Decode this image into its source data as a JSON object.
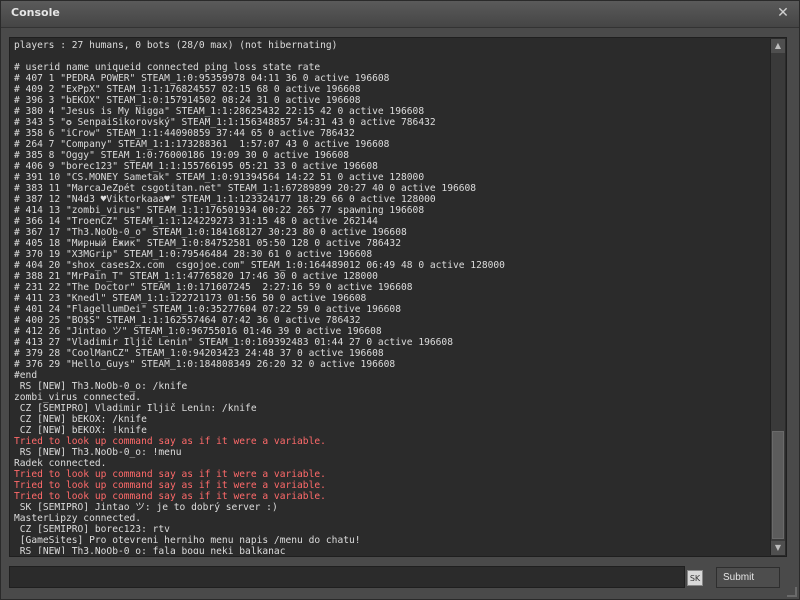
{
  "window": {
    "title": "Console",
    "close_icon": "close-icon"
  },
  "console": {
    "lines": [
      {
        "text": "players : 27 humans, 0 bots (28/0 max) (not hibernating)",
        "type": "normal"
      },
      {
        "text": "",
        "type": "normal"
      },
      {
        "text": "# userid name uniqueid connected ping loss state rate",
        "type": "normal"
      },
      {
        "text": "# 407 1 \"PEDRA POWER\" STEAM_1:0:95359978 04:11 36 0 active 196608",
        "type": "normal"
      },
      {
        "text": "# 409 2 \"ExPpX\" STEAM_1:1:176824557 02:15 68 0 active 196608",
        "type": "normal"
      },
      {
        "text": "# 396 3 \"bEKOX\" STEAM_1:0:157914502 08:24 31 0 active 196608",
        "type": "normal"
      },
      {
        "text": "# 380 4 \"Jesus is My Nigga\" STEAM_1:1:28625432 22:15 42 0 active 196608",
        "type": "normal"
      },
      {
        "text": "# 343 5 \"✪ SenpaiSikorovský\" STEAM_1:1:156348857 54:31 43 0 active 786432",
        "type": "normal"
      },
      {
        "text": "# 358 6 \"iCrow\" STEAM_1:1:44090859 37:44 65 0 active 786432",
        "type": "normal"
      },
      {
        "text": "# 264 7 \"Company\" STEAM_1:1:173288361  1:57:07 43 0 active 196608",
        "type": "normal"
      },
      {
        "text": "# 385 8 \"Oggy\" STEAM_1:0:76000186 19:09 30 0 active 196608",
        "type": "normal"
      },
      {
        "text": "# 406 9 \"borec123\" STEAM_1:1:155766195 05:21 33 0 active 196608",
        "type": "normal"
      },
      {
        "text": "# 391 10 \"CS.MONEY Sametak\" STEAM_1:0:91394564 14:22 51 0 active 128000",
        "type": "normal"
      },
      {
        "text": "# 383 11 \"MarcaJeZpét csgotitan.net\" STEAM_1:1:67289899 20:27 40 0 active 196608",
        "type": "normal"
      },
      {
        "text": "# 387 12 \"N4d3 ♥Viktorkaaa♥\" STEAM_1:1:123324177 18:29 66 0 active 128000",
        "type": "normal"
      },
      {
        "text": "# 414 13 \"zombi_virus\" STEAM_1:1:176501934 00:22 265 77 spawning 196608",
        "type": "normal"
      },
      {
        "text": "# 366 14 \"TroenCZ\" STEAM_1:1:124229273 31:15 48 0 active 262144",
        "type": "normal"
      },
      {
        "text": "# 367 17 \"Th3.NoOb-0_o\" STEAM_1:0:184168127 30:23 80 0 active 196608",
        "type": "normal"
      },
      {
        "text": "# 405 18 \"Мирный Ёжик\" STEAM_1:0:84752581 05:50 128 0 active 786432",
        "type": "normal"
      },
      {
        "text": "# 370 19 \"X3MGrip\" STEAM_1:0:79546484 28:30 61 0 active 196608",
        "type": "normal"
      },
      {
        "text": "# 404 20 \"shox_cases2x.com  csgojoe.com\" STEAM_1:0:164489012 06:49 48 0 active 128000",
        "type": "normal"
      },
      {
        "text": "# 388 21 \"MrPain_T\" STEAM_1:1:47765820 17:46 30 0 active 128000",
        "type": "normal"
      },
      {
        "text": "# 231 22 \"The Doctor\" STEAM_1:0:171607245  2:27:16 59 0 active 196608",
        "type": "normal"
      },
      {
        "text": "# 411 23 \"Knedl\" STEAM_1:1:122721173 01:56 50 0 active 196608",
        "type": "normal"
      },
      {
        "text": "# 401 24 \"FlagellumDei\" STEAM_1:0:35277604 07:22 59 0 active 196608",
        "type": "normal"
      },
      {
        "text": "# 400 25 \"BO$S\" STEAM_1:1:162557464 07:42 36 0 active 786432",
        "type": "normal"
      },
      {
        "text": "# 412 26 \"Jintao ツ\" STEAM_1:0:96755016 01:46 39 0 active 196608",
        "type": "normal"
      },
      {
        "text": "# 413 27 \"Vladimir Iljič Lenin\" STEAM_1:0:169392483 01:44 27 0 active 196608",
        "type": "normal"
      },
      {
        "text": "# 379 28 \"CoolManCZ\" STEAM_1:0:94203423 24:48 37 0 active 196608",
        "type": "normal"
      },
      {
        "text": "# 376 29 \"Hello_Guys\" STEAM_1:0:184808349 26:20 32 0 active 196608",
        "type": "normal"
      },
      {
        "text": "#end",
        "type": "normal"
      },
      {
        "text": " RS [NEW] Th3.NoOb-0_o: /knife",
        "type": "normal"
      },
      {
        "text": "zombi_virus connected.",
        "type": "normal"
      },
      {
        "text": " CZ [SEMIPRO] Vladimir Iljič Lenin: /knife",
        "type": "normal"
      },
      {
        "text": " CZ [NEW] bEKOX: /knife",
        "type": "normal"
      },
      {
        "text": " CZ [NEW] bEKOX: !knife",
        "type": "normal"
      },
      {
        "text": "Tried to look up command say as if it were a variable.",
        "type": "err"
      },
      {
        "text": " RS [NEW] Th3.NoOb-0_o: !menu",
        "type": "normal"
      },
      {
        "text": "Radek connected.",
        "type": "normal"
      },
      {
        "text": "Tried to look up command say as if it were a variable.",
        "type": "err"
      },
      {
        "text": "Tried to look up command say as if it were a variable.",
        "type": "err"
      },
      {
        "text": "Tried to look up command say as if it were a variable.",
        "type": "err"
      },
      {
        "text": " SK [SEMIPRO] Jintao ツ: je to dobrý server :)",
        "type": "normal"
      },
      {
        "text": "MasterLipzy connected.",
        "type": "normal"
      },
      {
        "text": " CZ [SEMIPRO] borec123: rtv",
        "type": "normal"
      },
      {
        "text": " [GameSites] Pro otevreni herniho menu napis /menu do chatu!",
        "type": "normal"
      },
      {
        "text": " RS [NEW] Th3.NoOb-0_o: fala bogu neki balkanac",
        "type": "normal"
      }
    ]
  },
  "input": {
    "value": "",
    "placeholder": ""
  },
  "sk_badge": "SK",
  "submit_label": "Submit",
  "scrollbar": {
    "up_icon": "▲",
    "down_icon": "▼"
  }
}
